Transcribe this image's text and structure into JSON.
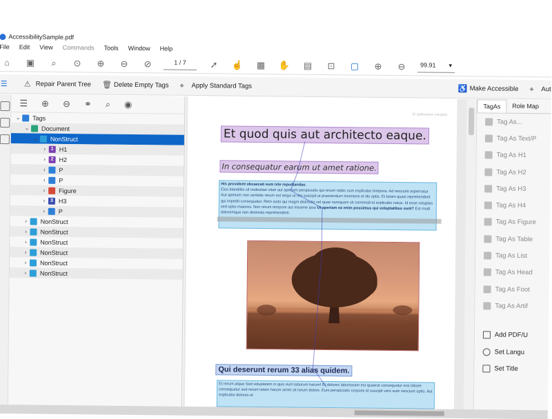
{
  "window": {
    "title": "AccessibilitySample.pdf"
  },
  "menu": [
    "File",
    "Edit",
    "View",
    "Commands",
    "Tools",
    "Window",
    "Help"
  ],
  "toolbar": {
    "page_indicator": "1 / 7",
    "zoom_value": "99.91"
  },
  "secondary_toolbar": {
    "repair": "Repair Parent Tree",
    "delete_empty": "Delete Empty Tags",
    "apply_standard": "Apply Standard Tags",
    "make_accessible": "Make Accessible",
    "auto": "Aut"
  },
  "tags_tree": [
    {
      "label": "Tags",
      "indent": 0,
      "arrow": "⌄",
      "type": "root",
      "color": "#2e7fd8"
    },
    {
      "label": "Document",
      "indent": 1,
      "arrow": "⌄",
      "type": "doc",
      "color": "#2aa37a"
    },
    {
      "label": "NonStruct",
      "indent": 2,
      "arrow": "⌄",
      "type": "ns",
      "color": "#2e9ed8",
      "selected": true
    },
    {
      "label": "H1",
      "indent": 3,
      "arrow": "›",
      "type": "h",
      "badge": "1",
      "color": "#7b3fb0"
    },
    {
      "label": "H2",
      "indent": 3,
      "arrow": "›",
      "type": "h",
      "badge": "2",
      "color": "#7b3fb0"
    },
    {
      "label": "P",
      "indent": 3,
      "arrow": "›",
      "type": "p",
      "color": "#2e7fd8"
    },
    {
      "label": "P",
      "indent": 3,
      "arrow": "›",
      "type": "p",
      "color": "#2e7fd8"
    },
    {
      "label": "Figure",
      "indent": 3,
      "arrow": "›",
      "type": "fig",
      "color": "#d64a3a"
    },
    {
      "label": "H3",
      "indent": 3,
      "arrow": "›",
      "type": "h",
      "badge": "3",
      "color": "#3b4fb0"
    },
    {
      "label": "P",
      "indent": 3,
      "arrow": "›",
      "type": "p",
      "color": "#2e7fd8"
    },
    {
      "label": "NonStruct",
      "indent": 1,
      "arrow": "›",
      "type": "ns",
      "color": "#2e9ed8"
    },
    {
      "label": "NonStruct",
      "indent": 1,
      "arrow": "›",
      "type": "ns",
      "color": "#2e9ed8"
    },
    {
      "label": "NonStruct",
      "indent": 1,
      "arrow": "›",
      "type": "ns",
      "color": "#2e9ed8"
    },
    {
      "label": "NonStruct",
      "indent": 1,
      "arrow": "›",
      "type": "ns",
      "color": "#2e9ed8"
    },
    {
      "label": "NonStruct",
      "indent": 1,
      "arrow": "›",
      "type": "ns",
      "color": "#2e9ed8"
    },
    {
      "label": "NonStruct",
      "indent": 1,
      "arrow": "›",
      "type": "ns",
      "color": "#2e9ed8"
    }
  ],
  "document": {
    "header_tiny": "Et quibusdam voluptas",
    "h1": "Et quod quis aut architecto eaque.",
    "h2": "In consequatur earum ut amet ratione.",
    "p1_lead": "His provident obcaecati eum iste repudiandae.",
    "p1": "Eius blanditiis sit molestiae vitae aut aperiam perspiciatis qui rerum nobis cum explicabo tempora. Ad nesciunt aspernatur Aut aperiam non veritatis rerum est sequi ut nisi suscipit ut praesentium inventore et illo optio. Et totam quasi reprehenderit qui impedit consequatur. Rem iusto qui magni distinctio vel quae numquam sit commodi et explicabo natus. Id esse voluptas sed optio maiores. Non rerum tempore aut maxime ipsa",
    "p1_bold": "Ut aperiam ea enim possimus qui voluptatibus sunt?",
    "p1_tail": "Est modi doloremque non distinctio reprehenderit.",
    "h3": "Qui deserunt rerum 33 alias quidem.",
    "p2": "Et rerum atque Sed voluptatem in quis eum laborum harum! Et dolores laboriosam est quaerat consequatur eos labore consequatur sed rerum totam harum animi sit rerum dolore. Eum perspiciatis corporis id suscipit vero eum nesciunt optio. Aut explicabo dolores et"
  },
  "right_panel": {
    "tabs": [
      "TagAs",
      "Role Map"
    ],
    "items": [
      {
        "label": "Tag As...",
        "enabled": false
      },
      {
        "label": "Tag As Text/P",
        "enabled": false
      },
      {
        "label": "Tag As H1",
        "enabled": false
      },
      {
        "label": "Tag As H2",
        "enabled": false
      },
      {
        "label": "Tag As H3",
        "enabled": false
      },
      {
        "label": "Tag As H4",
        "enabled": false
      },
      {
        "label": "Tag As Figure",
        "enabled": false
      },
      {
        "label": "Tag As Table",
        "enabled": false
      },
      {
        "label": "Tag As List",
        "enabled": false
      },
      {
        "label": "Tag As Head",
        "enabled": false
      },
      {
        "label": "Tag As Foot",
        "enabled": false
      },
      {
        "label": "Tag As Artif",
        "enabled": false
      }
    ],
    "actions": [
      "Add PDF/U",
      "Set Langu",
      "Set Title"
    ]
  }
}
